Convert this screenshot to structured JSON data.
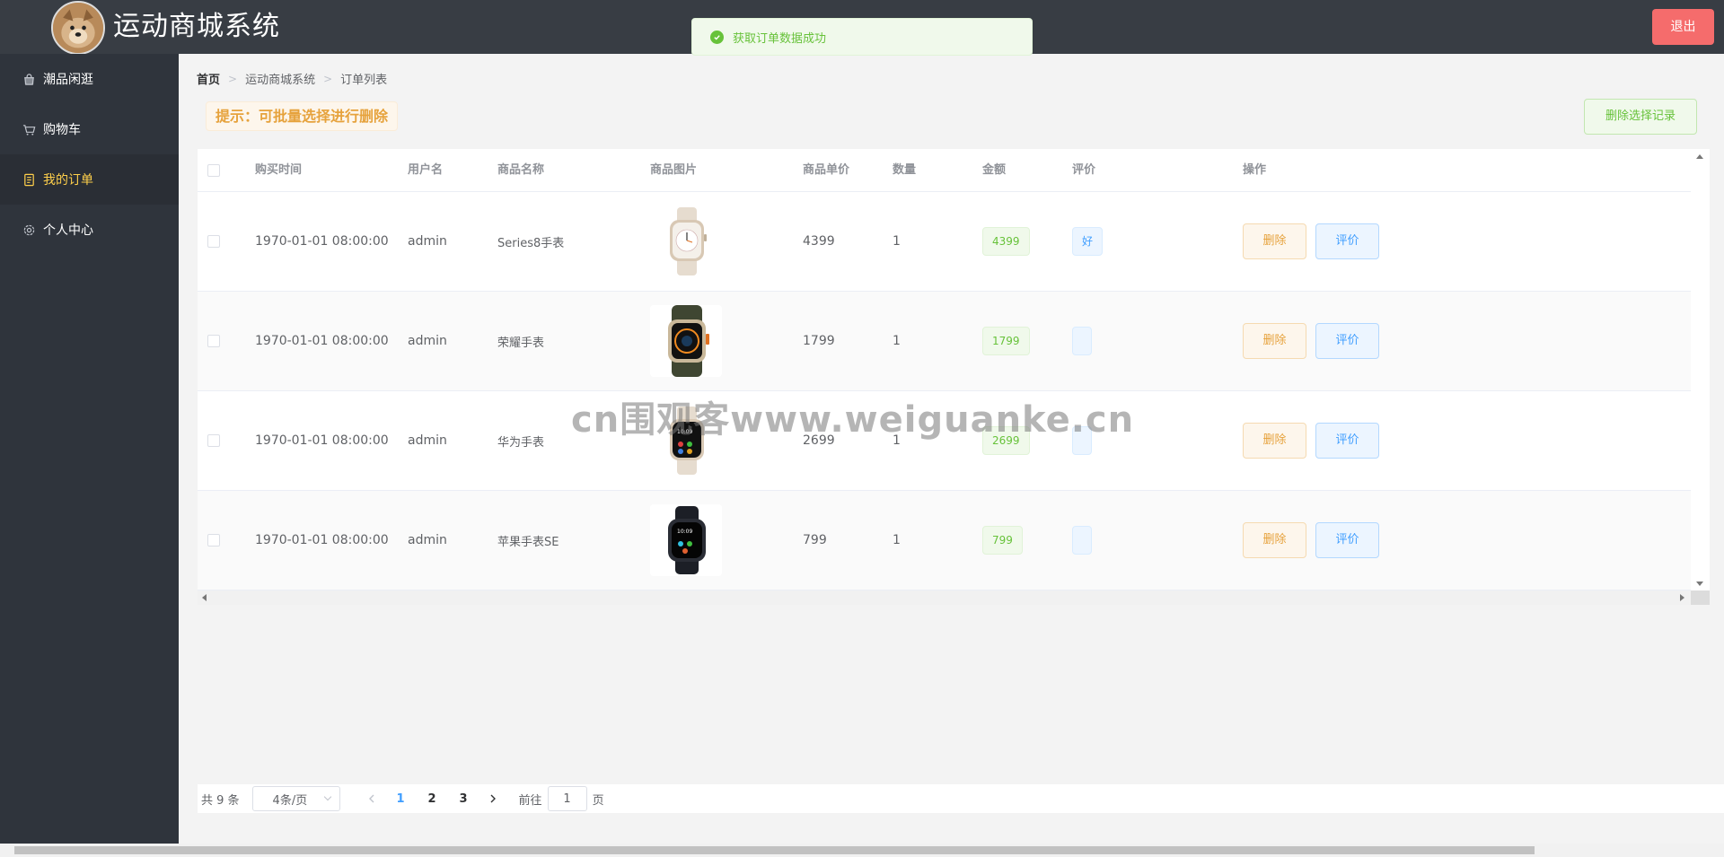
{
  "header": {
    "title": "运动商城系统",
    "logout_label": "退出"
  },
  "toast": {
    "message": "获取订单数据成功",
    "icon": "success-check-icon"
  },
  "sidebar": {
    "items": [
      {
        "label": "潮品闲逛",
        "icon": "shopping-bag-icon",
        "active": false
      },
      {
        "label": "购物车",
        "icon": "cart-icon",
        "active": false
      },
      {
        "label": "我的订单",
        "icon": "document-icon",
        "active": true
      },
      {
        "label": "个人中心",
        "icon": "gear-icon",
        "active": false
      }
    ]
  },
  "breadcrumb": [
    "首页",
    "运动商城系统",
    "订单列表"
  ],
  "tip": "提示：可批量选择进行删除",
  "delete_selected_label": "删除选择记录",
  "table": {
    "headers": {
      "time": "购买时间",
      "user": "用户名",
      "name": "商品名称",
      "image": "商品图片",
      "price": "商品单价",
      "qty": "数量",
      "amount": "金额",
      "review": "评价",
      "actions": "操作"
    },
    "rows": [
      {
        "time": "1970-01-01 08:00:00",
        "user": "admin",
        "name": "Series8手表",
        "price": "4399",
        "qty": "1",
        "amount": "4399",
        "review": "好",
        "image": "watch-starlight-icon"
      },
      {
        "time": "1970-01-01 08:00:00",
        "user": "admin",
        "name": "荣耀手表",
        "price": "1799",
        "qty": "1",
        "amount": "1799",
        "review": "",
        "image": "watch-ultra-olive-icon"
      },
      {
        "time": "1970-01-01 08:00:00",
        "user": "admin",
        "name": "华为手表",
        "price": "2699",
        "qty": "1",
        "amount": "2699",
        "review": "",
        "image": "watch-starlight-dark-icon"
      },
      {
        "time": "1970-01-01 08:00:00",
        "user": "admin",
        "name": "苹果手表SE",
        "price": "799",
        "qty": "1",
        "amount": "799",
        "review": "",
        "image": "watch-midnight-icon"
      }
    ],
    "delete_label": "删除",
    "review_label": "评价"
  },
  "watermark": "cn围观客www.weiguanke.cn",
  "pagination": {
    "total": "共 9 条",
    "page_size": "4条/页",
    "pages": [
      "1",
      "2",
      "3"
    ],
    "current": "1",
    "goto_prefix": "前往",
    "goto_value": "1",
    "goto_suffix": "页"
  },
  "colors": {
    "header_bg": "#383d44",
    "sidebar_bg": "#2f343c",
    "active_menu": "#ffd04b",
    "logout": "#f56c6c",
    "success": "#67c23a",
    "warning": "#e6a23c",
    "primary": "#409eff"
  }
}
